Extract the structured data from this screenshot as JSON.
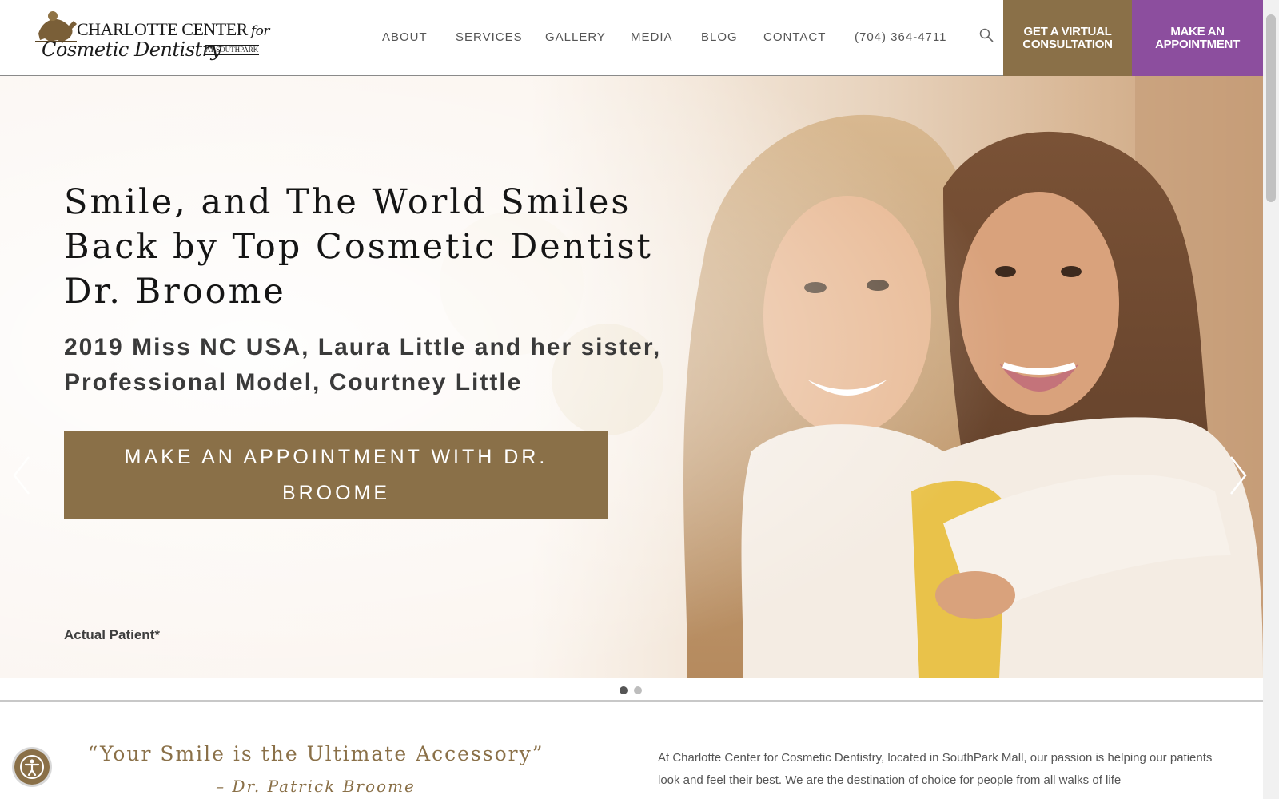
{
  "header": {
    "logo": {
      "line1": "CHARLOTTE CENTER",
      "line1_for": "for",
      "line2": "Cosmetic Dentistry",
      "southpark": "AT SOUTHPARK"
    },
    "nav": [
      "ABOUT",
      "SERVICES",
      "GALLERY",
      "MEDIA",
      "BLOG",
      "CONTACT",
      "(704) 364-4711"
    ],
    "search_icon": "search-icon",
    "cta_virtual": "GET A VIRTUAL CONSULTATION",
    "cta_appointment": "MAKE AN APPOINTMENT"
  },
  "hero": {
    "title": "Smile, and The World Smiles Back by Top Cosmetic Dentist Dr. Broome",
    "subtitle": "2019 Miss NC USA, Laura Little and her sister, Professional Model, Courtney Little",
    "button": "MAKE AN APPOINTMENT WITH DR. BROOME",
    "note": "Actual Patient*",
    "slides_total": 2,
    "slide_active": 1
  },
  "intro": {
    "quote": "“Your Smile is the Ultimate Accessory”",
    "quote_author": "– Dr. Patrick Broome",
    "text": "At Charlotte Center for Cosmetic Dentistry, located in SouthPark Mall, our passion is helping our patients look and feel their best. We are the destination of choice for people from all walks of life"
  },
  "colors": {
    "brand_gold": "#8a7048",
    "brand_purple": "#8c4e9e"
  }
}
